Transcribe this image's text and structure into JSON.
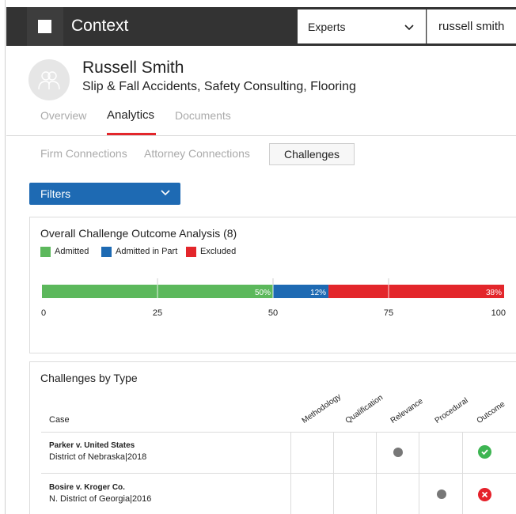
{
  "header": {
    "app_title": "Context",
    "search_type": "Experts",
    "search_value": "russell smith"
  },
  "profile": {
    "name": "Russell Smith",
    "specialties": "Slip & Fall Accidents, Safety Consulting, Flooring",
    "tabs": [
      "Overview",
      "Analytics",
      "Documents"
    ],
    "active_tab": "Analytics"
  },
  "subtabs": {
    "items": [
      "Firm Connections",
      "Attorney Connections",
      "Challenges"
    ],
    "active": "Challenges"
  },
  "filters": {
    "label": "Filters"
  },
  "outcome_panel": {
    "title": "Overall Challenge Outcome Analysis (8)",
    "legend": [
      {
        "label": "Admitted",
        "color": "#5cb85c"
      },
      {
        "label": "Admitted in Part",
        "color": "#1e6ab3"
      },
      {
        "label": "Excluded",
        "color": "#e3262b"
      }
    ]
  },
  "chart_data": {
    "type": "bar",
    "orientation": "horizontal-stacked",
    "series": [
      {
        "name": "Admitted",
        "values": [
          50
        ],
        "label": "50%",
        "color": "#5cb85c"
      },
      {
        "name": "Admitted in Part",
        "values": [
          12
        ],
        "label": "12%",
        "color": "#1e6ab3"
      },
      {
        "name": "Excluded",
        "values": [
          38
        ],
        "label": "38%",
        "color": "#e3262b"
      }
    ],
    "xlim": [
      0,
      100
    ],
    "x_ticks": [
      "0",
      "25",
      "50",
      "75",
      "100"
    ],
    "grid": true
  },
  "challenges_panel": {
    "title": "Challenges by Type",
    "case_header": "Case",
    "columns": [
      "Methodology",
      "Qualification",
      "Relevance",
      "Procedural",
      "Outcome"
    ],
    "rows": [
      {
        "case": "Parker v. United States",
        "court": "District of Nebraska|2018",
        "marks": [
          false,
          false,
          true,
          false
        ],
        "outcome": "admitted"
      },
      {
        "case": "Bosire v. Kroger Co.",
        "court": "N. District of Georgia|2016",
        "marks": [
          false,
          false,
          false,
          true
        ],
        "outcome": "excluded"
      }
    ]
  }
}
